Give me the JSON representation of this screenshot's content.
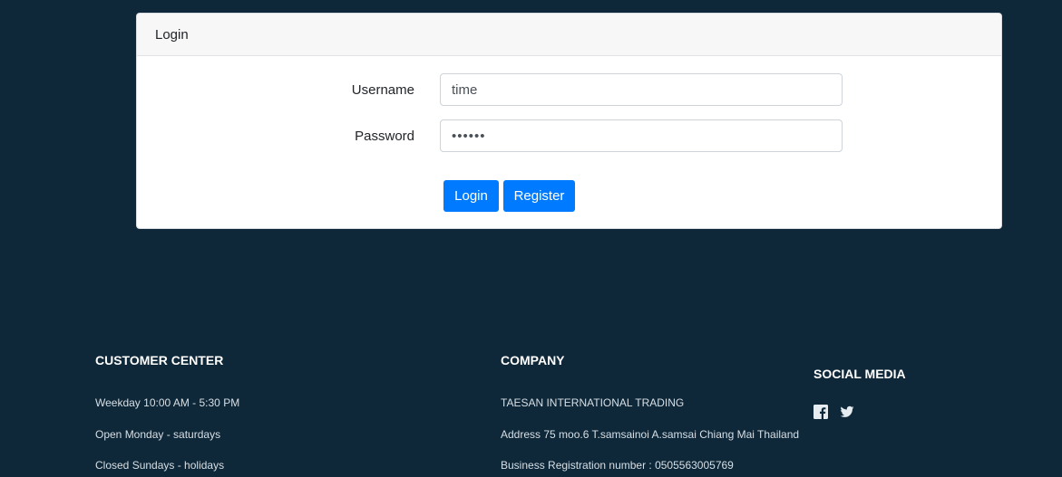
{
  "login": {
    "header": "Login",
    "username_label": "Username",
    "username_value": "time",
    "password_label": "Password",
    "password_value": "••••••",
    "login_button": "Login",
    "register_button": "Register"
  },
  "footer": {
    "customer_center": {
      "heading": "CUSTOMER CENTER",
      "lines": [
        "Weekday 10:00 AM - 5:30 PM",
        "Open Monday - saturdays",
        "Closed Sundays - holidays"
      ]
    },
    "company": {
      "heading": "COMPANY",
      "lines": [
        "TAESAN INTERNATIONAL TRADING",
        "Address 75 moo.6 T.samsainoi A.samsai Chiang Mai Thailand",
        "Business Registration number : 0505563005769"
      ]
    },
    "social": {
      "heading": "SOCIAL MEDIA",
      "icons": [
        "facebook-icon",
        "twitter-icon"
      ]
    }
  },
  "colors": {
    "background": "#0e283a",
    "primary": "#007bff"
  }
}
